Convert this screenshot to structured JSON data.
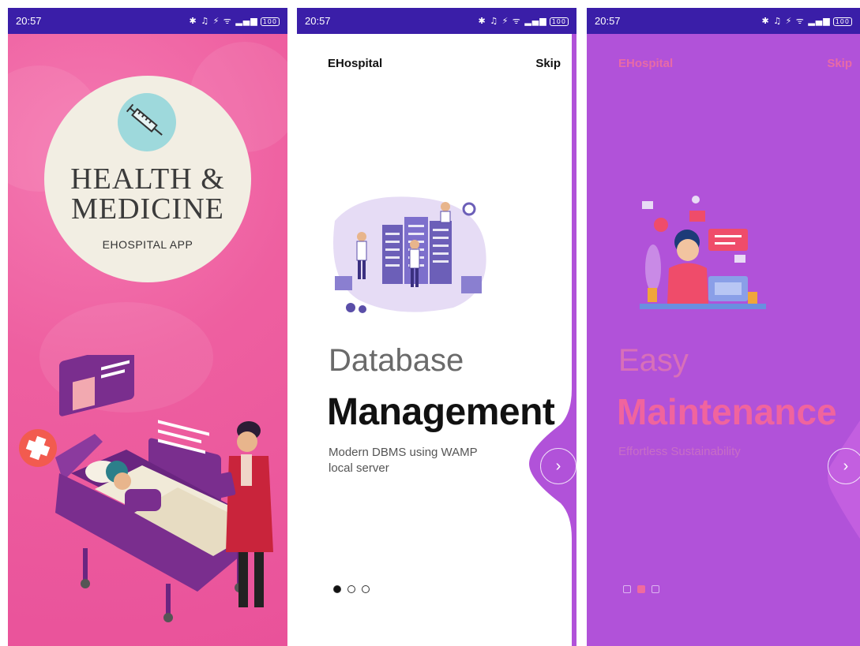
{
  "status": {
    "time": "20:57",
    "icons": "✱ ♫ ⚡ ᯤ ▂▄▆",
    "battery": "100"
  },
  "screen1": {
    "title_line1": "HEALTH &",
    "title_line2": "MEDICINE",
    "subtitle": "EHOSPITAL APP",
    "icons": [
      "syringe-icon",
      "medical-cross-icon",
      "hospital-bed-illustration",
      "doctor-illustration"
    ]
  },
  "screen2": {
    "app_name": "EHospital",
    "skip_label": "Skip",
    "heading_light": "Database",
    "heading_bold": "Management",
    "description": "Modern DBMS using WAMP local server",
    "next_label": "›",
    "page_count": 3,
    "active_page": 1
  },
  "screen3": {
    "app_name": "EHospital",
    "skip_label": "Skip",
    "heading_light": "Easy",
    "heading_bold": "Maintenance",
    "description": "Effortless Sustainability",
    "next_label": "›",
    "page_count": 3,
    "active_page": 2
  },
  "colors": {
    "statusbar": "#3a1ea8",
    "pink": "#ee5fa0",
    "purple": "#b152d9",
    "accent": "#f0649e"
  }
}
